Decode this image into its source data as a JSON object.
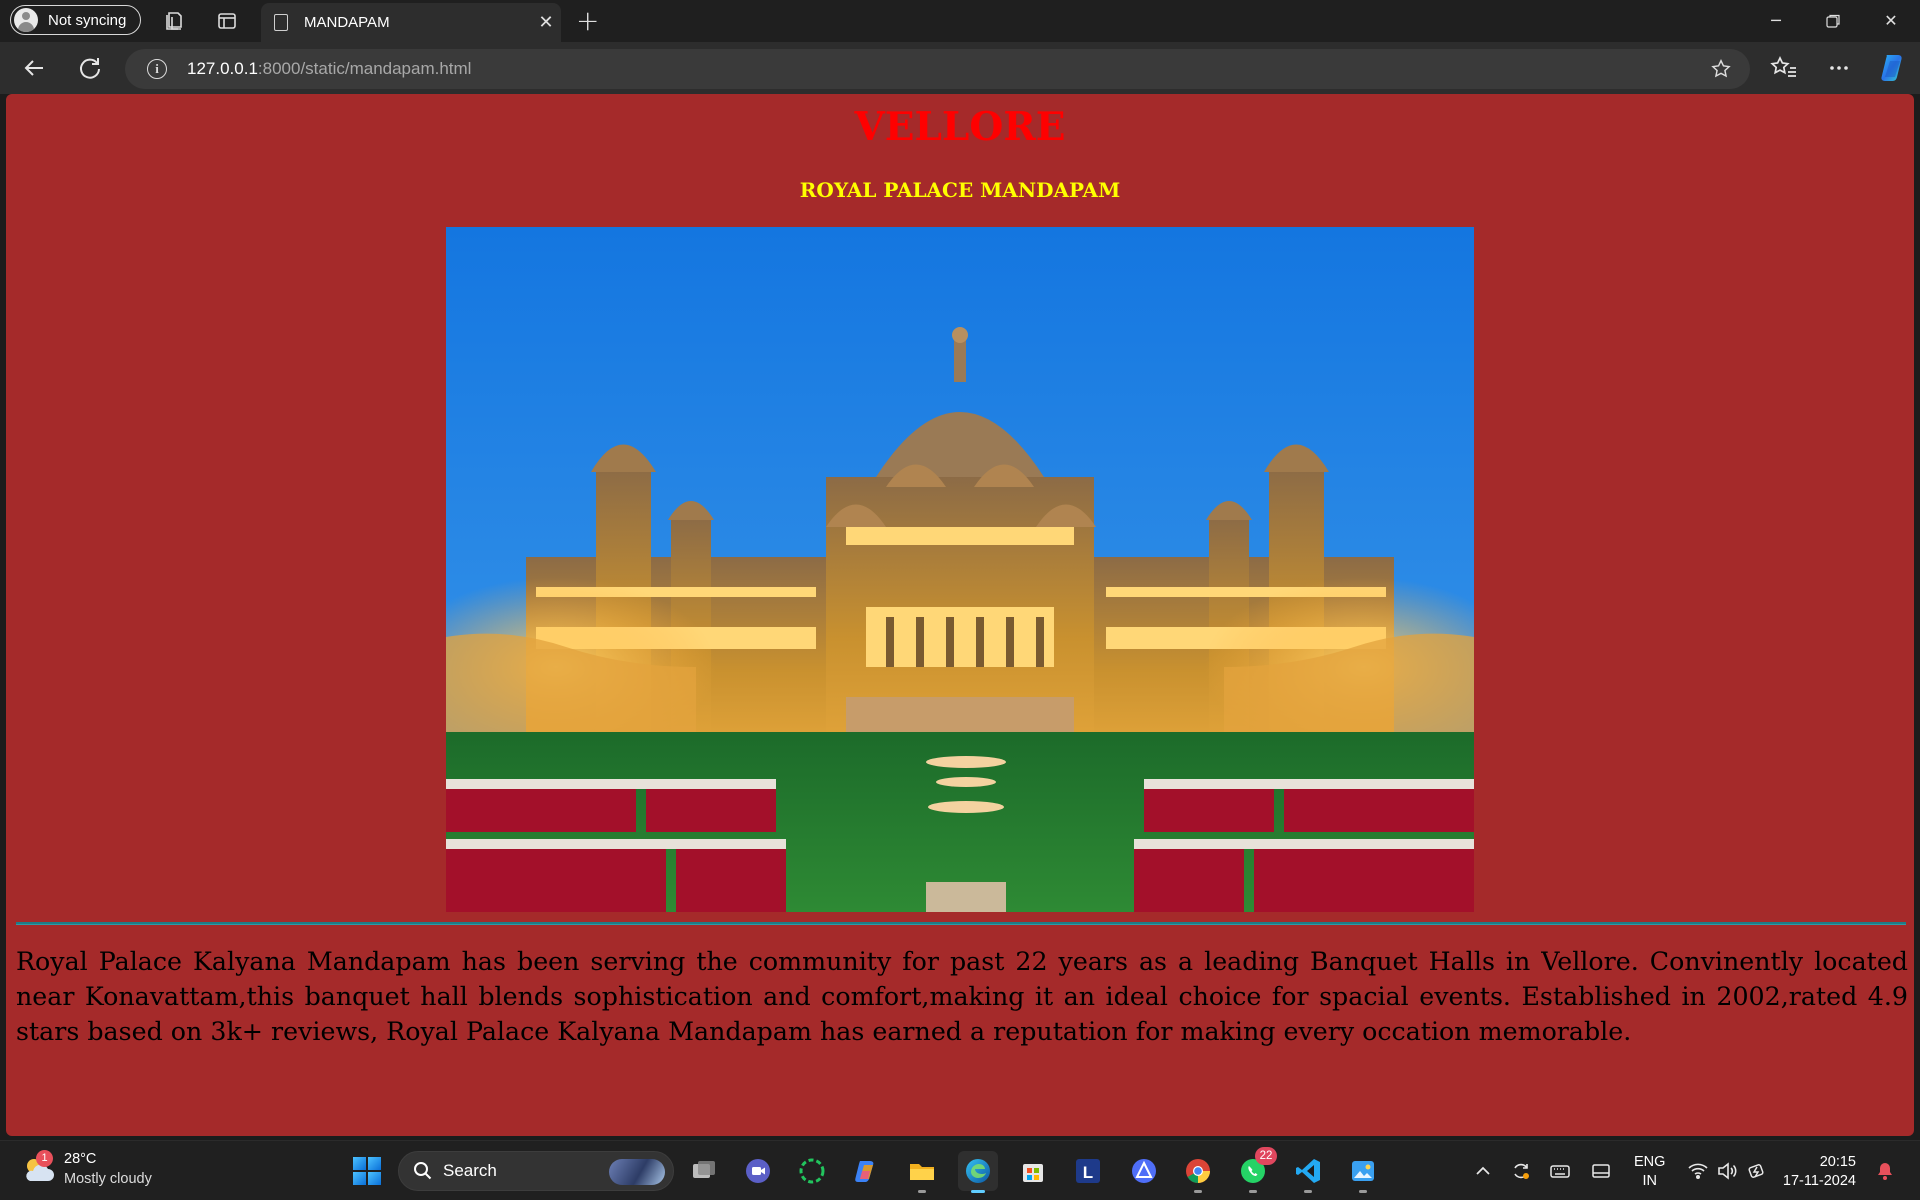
{
  "browser": {
    "profile_label": "Not syncing",
    "tab_title": "MANDAPAM",
    "url_host": "127.0.0.1",
    "url_rest": ":8000/static/mandapam.html"
  },
  "page": {
    "heading": "VELLORE",
    "subheading": "ROYAL PALACE MANDAPAM",
    "hero_image_icon": "palace-photo",
    "description": "Royal Palace Kalyana Mandapam has been serving the community for past 22 years as a leading Banquet Halls in Vellore. Convinently located near Konavattam,this banquet hall blends sophistication and comfort,making it an ideal choice for spacial events. Established in 2002,rated 4.9 stars based on 3k+ reviews, Royal Palace Kalyana Mandapam has earned a reputation for making every occation memorable.",
    "colors": {
      "background": "#a52a2a",
      "heading": "#ff0000",
      "subheading": "#ffff00",
      "divider": "#207b86"
    }
  },
  "taskbar": {
    "weather": {
      "temp": "28°C",
      "condition": "Mostly cloudy",
      "badge": "1"
    },
    "search_label": "Search",
    "whatsapp_badge": "22",
    "language": {
      "line1": "ENG",
      "line2": "IN"
    },
    "clock": {
      "time": "20:15",
      "date": "17-11-2024"
    },
    "apps": [
      "task-view",
      "teams-meet",
      "loader-app",
      "copilot",
      "file-explorer",
      "edge",
      "microsoft-store",
      "l-app",
      "affinity",
      "chrome",
      "whatsapp",
      "vscode",
      "photos"
    ]
  }
}
